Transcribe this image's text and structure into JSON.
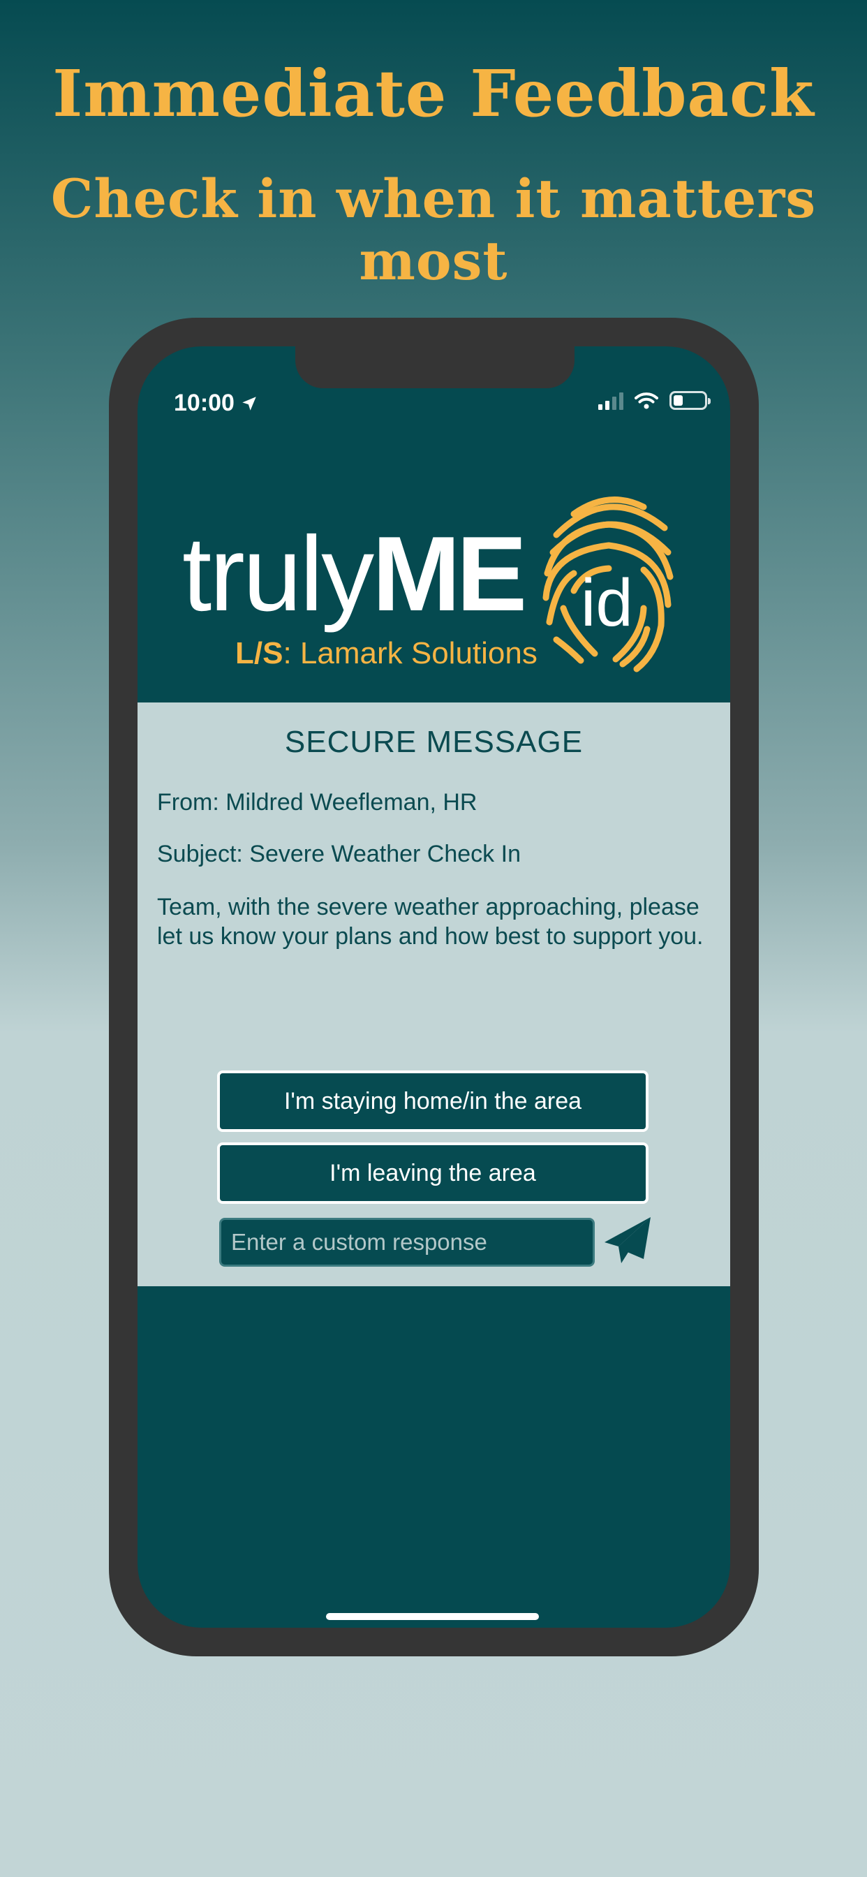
{
  "promo": {
    "headline": "Immediate Feedback",
    "subheadline": "Check in when it matters most"
  },
  "status_bar": {
    "time": "10:00",
    "location_icon": "location-arrow-icon",
    "signal_icon": "cellular-signal-icon",
    "wifi_icon": "wifi-icon",
    "battery_icon": "battery-icon",
    "battery_level": 0.3
  },
  "logo": {
    "word_light": "truly",
    "word_bold": "ME",
    "badge": "id",
    "sub_mark": "L/S",
    "sub_sep": ":",
    "sub_name": " Lamark Solutions",
    "icon": "fingerprint-icon"
  },
  "message": {
    "title": "SECURE MESSAGE",
    "from": "From: Mildred Weefleman, HR",
    "subject": "Subject: Severe Weather Check In",
    "body": "Team, with the severe weather approaching, please let us know your plans and how best to support you."
  },
  "responses": {
    "staying_label": "I'm staying home/in the area",
    "leaving_label": "I'm leaving the area",
    "custom_placeholder": "Enter a custom response",
    "send_icon": "paper-plane-icon"
  },
  "colors": {
    "brand_teal": "#064b51",
    "brand_gold": "#f6b444",
    "panel": "#c2d5d6",
    "phone_frame": "#353535"
  }
}
